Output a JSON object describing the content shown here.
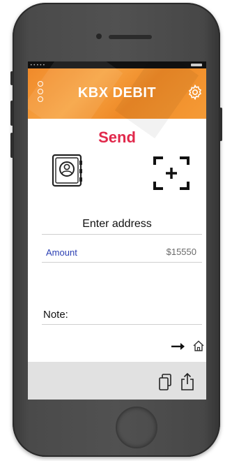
{
  "app": {
    "brand_title": "KBX DEBIT",
    "accent_color": "#f08a2a",
    "send_title_color": "#e1284b"
  },
  "send": {
    "title": "Send",
    "address_label": "Enter address",
    "amount_label": "Amount",
    "amount_value": "$15550",
    "note_label": "Note:"
  },
  "icons": {
    "menu": "menu-dots-icon",
    "settings": "gear-icon",
    "contacts": "address-book-icon",
    "scan": "scan-qr-icon",
    "arrow": "arrow-right-icon",
    "home": "home-icon",
    "copy": "copy-icon",
    "share": "share-icon"
  }
}
